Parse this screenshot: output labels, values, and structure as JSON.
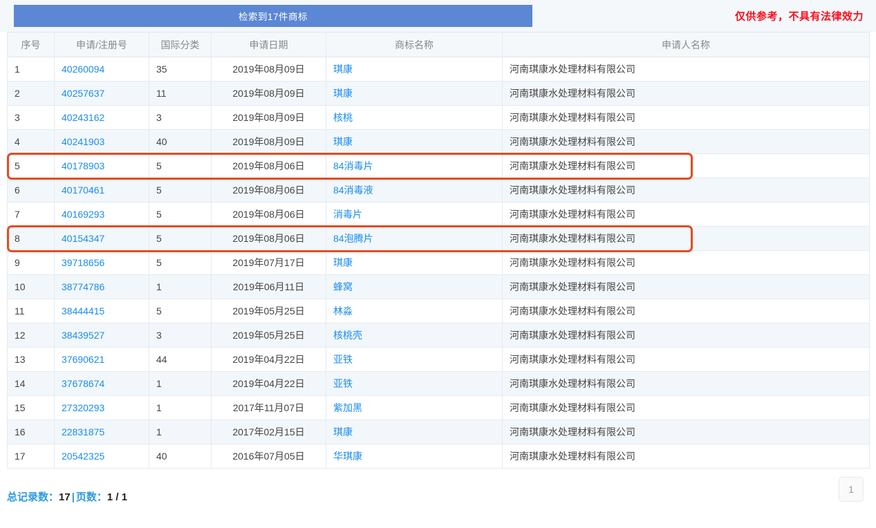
{
  "banner": {
    "result_text": "检索到17件商标",
    "disclaimer": "仅供参考，不具有法律效力",
    "banner_color": "#5b87d4",
    "disclaimer_color": "#fc0d1c"
  },
  "table": {
    "columns": [
      {
        "key": "seq",
        "label": "序号"
      },
      {
        "key": "regno",
        "label": "申请/注册号"
      },
      {
        "key": "cls",
        "label": "国际分类"
      },
      {
        "key": "date",
        "label": "申请日期"
      },
      {
        "key": "name",
        "label": "商标名称"
      },
      {
        "key": "appl",
        "label": "申请人名称"
      }
    ],
    "rows": [
      {
        "seq": "1",
        "regno": "40260094",
        "cls": "35",
        "date": "2019年08月09日",
        "name": "琪康",
        "appl": "河南琪康水处理材料有限公司",
        "highlight": false
      },
      {
        "seq": "2",
        "regno": "40257637",
        "cls": "11",
        "date": "2019年08月09日",
        "name": "琪康",
        "appl": "河南琪康水处理材料有限公司",
        "highlight": false
      },
      {
        "seq": "3",
        "regno": "40243162",
        "cls": "3",
        "date": "2019年08月09日",
        "name": "核桃",
        "appl": "河南琪康水处理材料有限公司",
        "highlight": false
      },
      {
        "seq": "4",
        "regno": "40241903",
        "cls": "40",
        "date": "2019年08月09日",
        "name": "琪康",
        "appl": "河南琪康水处理材料有限公司",
        "highlight": false
      },
      {
        "seq": "5",
        "regno": "40178903",
        "cls": "5",
        "date": "2019年08月06日",
        "name": "84消毒片",
        "appl": "河南琪康水处理材料有限公司",
        "highlight": true
      },
      {
        "seq": "6",
        "regno": "40170461",
        "cls": "5",
        "date": "2019年08月06日",
        "name": "84消毒液",
        "appl": "河南琪康水处理材料有限公司",
        "highlight": false
      },
      {
        "seq": "7",
        "regno": "40169293",
        "cls": "5",
        "date": "2019年08月06日",
        "name": "消毒片",
        "appl": "河南琪康水处理材料有限公司",
        "highlight": false
      },
      {
        "seq": "8",
        "regno": "40154347",
        "cls": "5",
        "date": "2019年08月06日",
        "name": "84泡腾片",
        "appl": "河南琪康水处理材料有限公司",
        "highlight": true
      },
      {
        "seq": "9",
        "regno": "39718656",
        "cls": "5",
        "date": "2019年07月17日",
        "name": "琪康",
        "appl": "河南琪康水处理材料有限公司",
        "highlight": false
      },
      {
        "seq": "10",
        "regno": "38774786",
        "cls": "1",
        "date": "2019年06月11日",
        "name": "蜂窝",
        "appl": "河南琪康水处理材料有限公司",
        "highlight": false
      },
      {
        "seq": "11",
        "regno": "38444415",
        "cls": "5",
        "date": "2019年05月25日",
        "name": "林淼",
        "appl": "河南琪康水处理材料有限公司",
        "highlight": false
      },
      {
        "seq": "12",
        "regno": "38439527",
        "cls": "3",
        "date": "2019年05月25日",
        "name": "核桃壳",
        "appl": "河南琪康水处理材料有限公司",
        "highlight": false
      },
      {
        "seq": "13",
        "regno": "37690621",
        "cls": "44",
        "date": "2019年04月22日",
        "name": "亚铁",
        "appl": "河南琪康水处理材料有限公司",
        "highlight": false
      },
      {
        "seq": "14",
        "regno": "37678674",
        "cls": "1",
        "date": "2019年04月22日",
        "name": "亚铁",
        "appl": "河南琪康水处理材料有限公司",
        "highlight": false
      },
      {
        "seq": "15",
        "regno": "27320293",
        "cls": "1",
        "date": "2017年11月07日",
        "name": "紫加黑",
        "appl": "河南琪康水处理材料有限公司",
        "highlight": false
      },
      {
        "seq": "16",
        "regno": "22831875",
        "cls": "1",
        "date": "2017年02月15日",
        "name": "琪康",
        "appl": "河南琪康水处理材料有限公司",
        "highlight": false
      },
      {
        "seq": "17",
        "regno": "20542325",
        "cls": "40",
        "date": "2016年07月05日",
        "name": "华琪康",
        "appl": "河南琪康水处理材料有限公司",
        "highlight": false
      }
    ]
  },
  "footer": {
    "total_label": "总记录数：",
    "total_value": "17",
    "separator": "|",
    "page_label": "页数：",
    "page_value": "1 / 1",
    "pagination": [
      "1"
    ],
    "active_page": "1"
  },
  "colors": {
    "link": "#1a8cf0",
    "highlight_box": "#e8491f",
    "header_bg": "#f4f8fb",
    "row_alt_bg": "#f2f7fb"
  }
}
